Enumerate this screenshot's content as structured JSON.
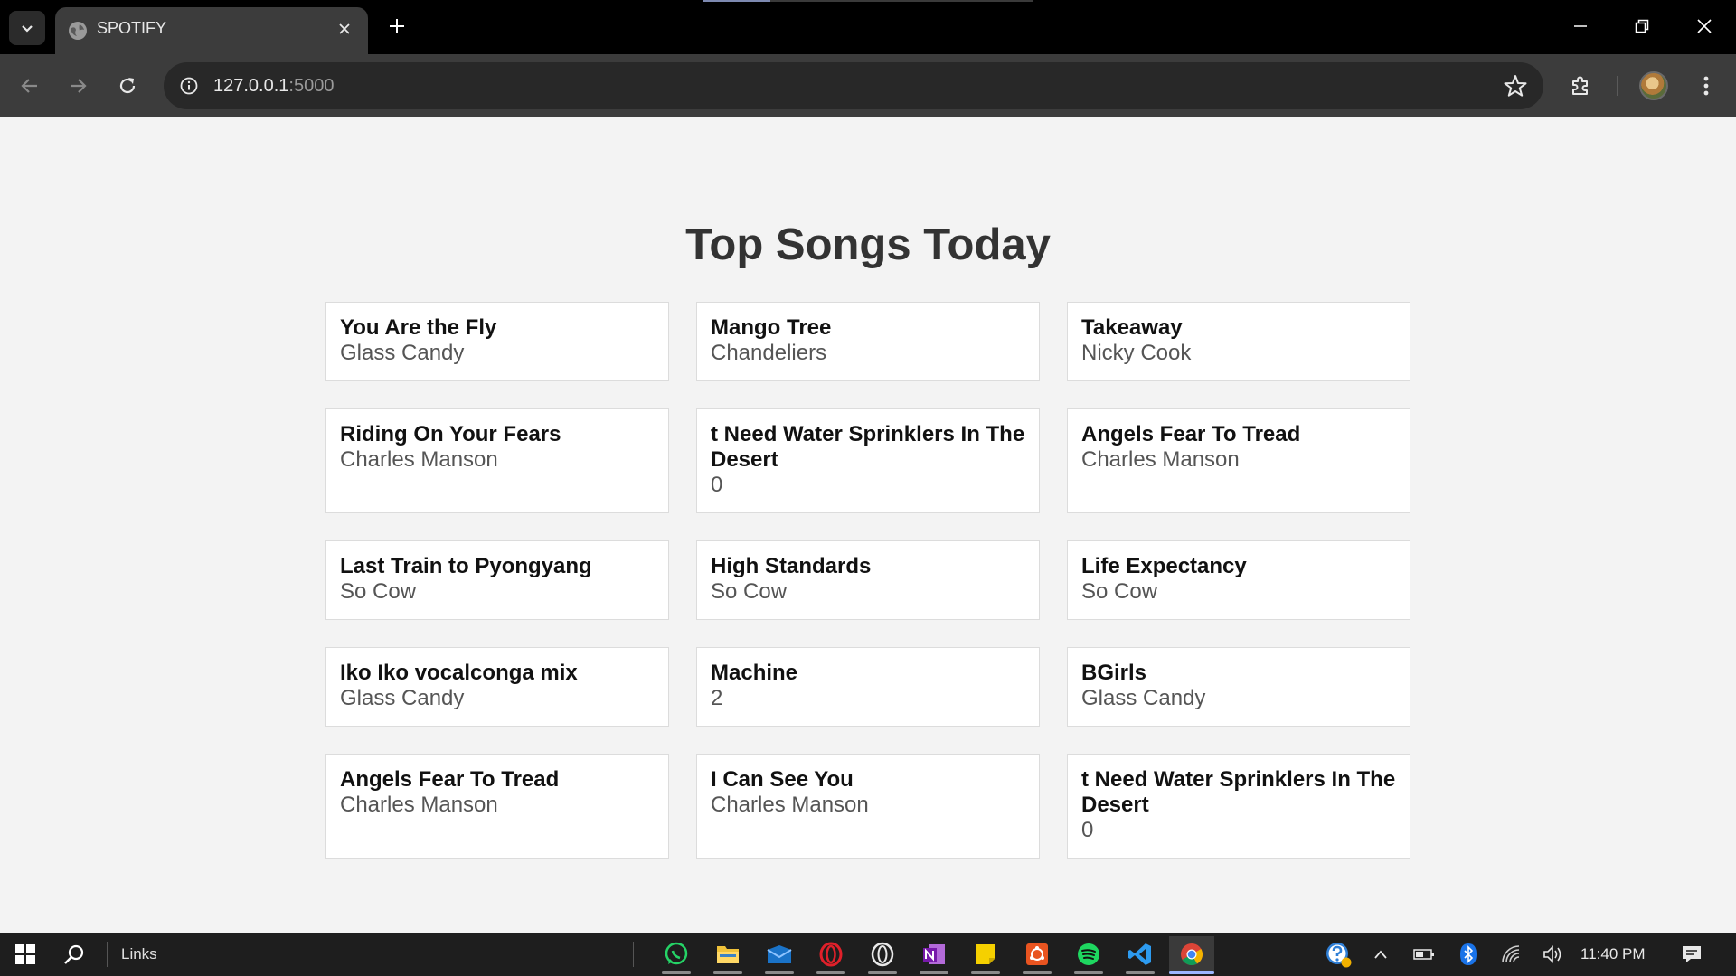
{
  "browser": {
    "tab_title": "SPOTIFY",
    "url_host": "127.0.0.1",
    "url_port": ":5000"
  },
  "page": {
    "heading": "Top Songs Today",
    "songs": [
      {
        "title": "You Are the Fly",
        "artist": "Glass Candy"
      },
      {
        "title": "Mango Tree",
        "artist": "Chandeliers"
      },
      {
        "title": "Takeaway",
        "artist": "Nicky Cook"
      },
      {
        "title": "Riding On Your Fears",
        "artist": "Charles Manson"
      },
      {
        "title": "t Need Water Sprinklers In The Desert",
        "artist": "0"
      },
      {
        "title": "Angels Fear To Tread",
        "artist": "Charles Manson"
      },
      {
        "title": "Last Train to Pyongyang",
        "artist": "So Cow"
      },
      {
        "title": "High Standards",
        "artist": "So Cow"
      },
      {
        "title": "Life Expectancy",
        "artist": "So Cow"
      },
      {
        "title": "Iko Iko vocalconga mix",
        "artist": "Glass Candy"
      },
      {
        "title": "Machine",
        "artist": "2"
      },
      {
        "title": "BGirls",
        "artist": "Glass Candy"
      },
      {
        "title": "Angels Fear To Tread",
        "artist": "Charles Manson"
      },
      {
        "title": "I Can See You",
        "artist": "Charles Manson"
      },
      {
        "title": "t Need Water Sprinklers In The Desert",
        "artist": "0"
      }
    ]
  },
  "taskbar": {
    "toolbar_label": "Links",
    "time": "11:40 PM",
    "pinned_apps": [
      "whatsapp-icon",
      "file-explorer-icon",
      "mail-icon",
      "opera-icon",
      "opera-gx-icon",
      "onenote-icon",
      "sticky-notes-icon",
      "ubuntu-icon",
      "spotify-icon",
      "vscode-icon",
      "chrome-icon"
    ]
  },
  "colors": {
    "page_bg": "#f3f3f3",
    "card_bg": "#ffffff",
    "tabstrip_bg": "#000000",
    "toolbar_bg": "#3c3c3c",
    "taskbar_bg": "#1e1e1e"
  }
}
